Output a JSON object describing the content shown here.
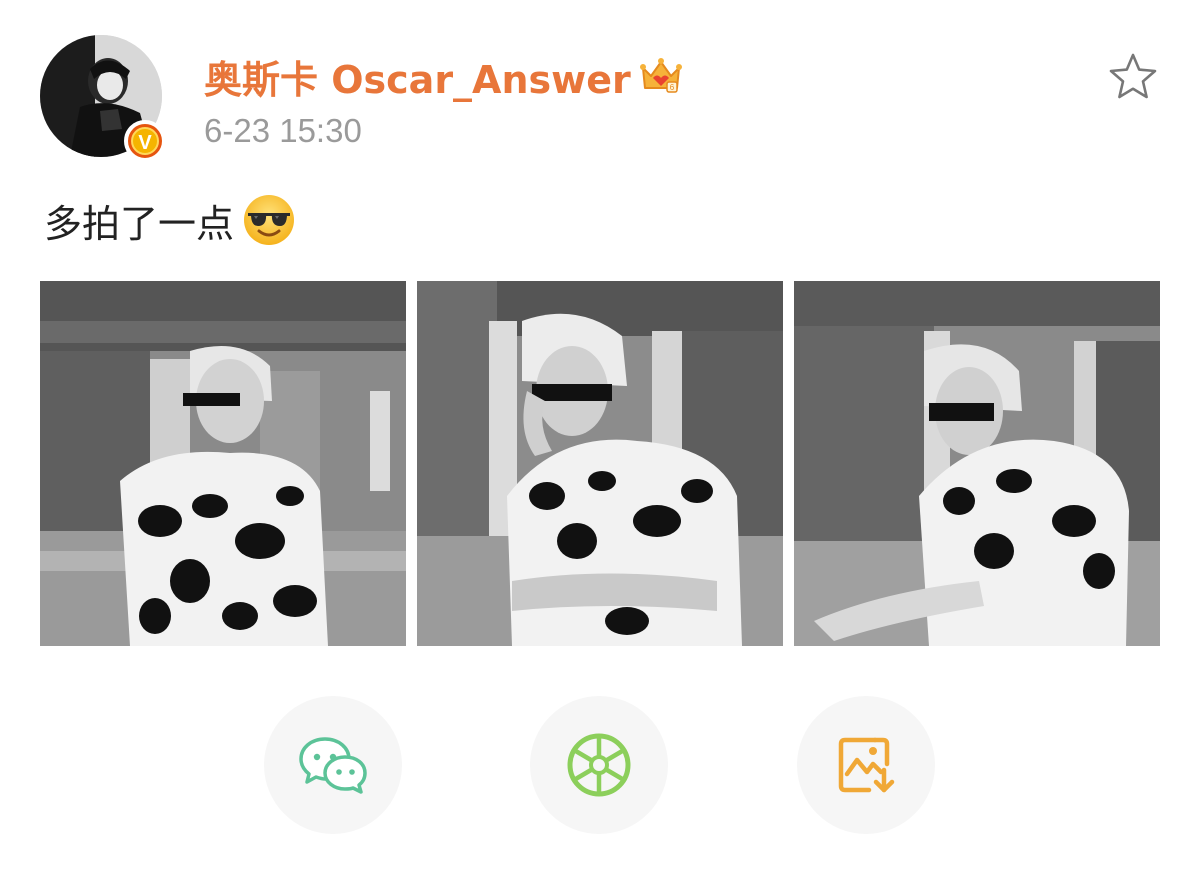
{
  "post": {
    "author": "奥斯卡 Oscar_Answer",
    "timestamp": "6-23 15:30",
    "text": "多拍了一点",
    "emoji": "sunglasses-face-emoji",
    "photo_count": 3
  },
  "badges": {
    "verified": "V",
    "verified_color": "#e6550f",
    "member_crown": "crown-icon"
  },
  "colors": {
    "username": "#e8763a",
    "timestamp": "#9a9a9a",
    "wechat_green": "#5cc398",
    "moments_green": "#8ccf5b",
    "save_orange": "#f0a836"
  },
  "actions": [
    {
      "icon": "wechat-icon"
    },
    {
      "icon": "moments-shutter-icon"
    },
    {
      "icon": "save-image-icon"
    }
  ]
}
